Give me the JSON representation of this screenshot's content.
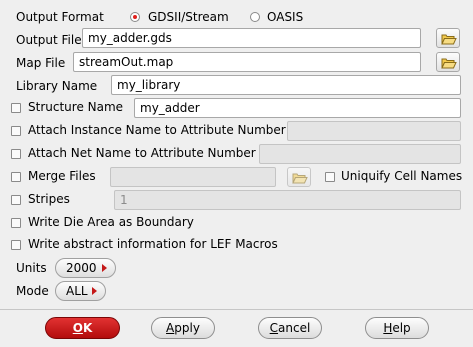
{
  "output_format": {
    "label": "Output Format",
    "options": [
      {
        "label": "GDSII/Stream",
        "selected": true
      },
      {
        "label": "OASIS",
        "selected": false
      }
    ]
  },
  "output_file": {
    "label": "Output File",
    "value": "my_adder.gds"
  },
  "map_file": {
    "label": "Map File",
    "value": "streamOut.map"
  },
  "library_name": {
    "label": "Library Name",
    "value": "my_library"
  },
  "structure_name": {
    "label": "Structure Name",
    "value": "my_adder",
    "checked": false
  },
  "attach_instance": {
    "label": "Attach Instance Name to Attribute Number",
    "value": "",
    "checked": false
  },
  "attach_net": {
    "label": "Attach Net Name to Attribute Number",
    "value": "",
    "checked": false
  },
  "merge_files": {
    "label": "Merge Files",
    "value": "",
    "checked": false
  },
  "uniquify": {
    "label": "Uniquify Cell Names",
    "checked": false
  },
  "stripes": {
    "label": "Stripes",
    "value": "1",
    "checked": false
  },
  "die_area": {
    "label": "Write Die Area as Boundary",
    "checked": false
  },
  "lef_abstract": {
    "label": "Write abstract information for LEF Macros",
    "checked": false
  },
  "units": {
    "label": "Units",
    "value": "2000"
  },
  "mode": {
    "label": "Mode",
    "value": "ALL"
  },
  "buttons": {
    "ok": {
      "first": "O",
      "rest": "K"
    },
    "apply": {
      "first": "A",
      "rest": "pply"
    },
    "cancel": {
      "first": "C",
      "rest": "ancel"
    },
    "help": {
      "first": "H",
      "rest": "elp"
    }
  },
  "colors": {
    "accent": "#c41818",
    "background": "#efefef",
    "ok_button": "#c81e1e"
  },
  "icons": {
    "browse": "folder-open-icon",
    "dropdown": "triangle-right-icon"
  }
}
